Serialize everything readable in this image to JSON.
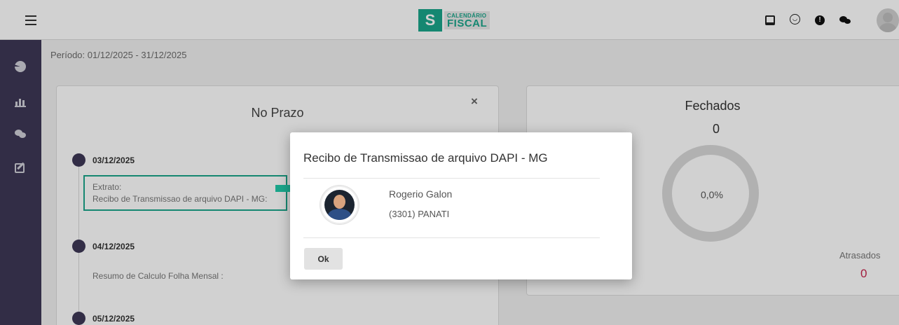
{
  "app": {
    "logo_small": "CALENDÁRIO",
    "logo_big": "FISCAL",
    "logo_mark": "S"
  },
  "header": {
    "icons": [
      "menu-icon",
      "tablet-icon",
      "smile-icon",
      "alert-icon",
      "chat-icon",
      "user-avatar"
    ]
  },
  "sidebar": {
    "icons": [
      "pie-chart-icon",
      "bar-chart-icon",
      "chat-icon",
      "edit-icon"
    ]
  },
  "periodo": "Período: 01/12/2025 - 31/12/2025",
  "no_prazo": {
    "title": "No Prazo",
    "close": "×",
    "items": [
      {
        "date": "03/12/2025",
        "desc_line1": "Extrato:",
        "desc_line2": "Recibo de Transmissao de arquivo DAPI - MG:"
      },
      {
        "date": "04/12/2025",
        "desc_line1": "Resumo de Calculo Folha Mensal :"
      },
      {
        "date": "05/12/2025"
      }
    ]
  },
  "fechados": {
    "title": "Fechados",
    "count": "0",
    "percent": "0,0%",
    "atrasados_label": "Atrasados",
    "atrasados_value": "0"
  },
  "modal": {
    "title": "Recibo de Transmissao de arquivo DAPI - MG",
    "name": "Rogerio Galon",
    "company": "(3301) PANATI",
    "ok": "Ok"
  },
  "colors": {
    "sidebar": "#3e3756",
    "accent": "#1aa58a",
    "alert": "#c6244c"
  }
}
